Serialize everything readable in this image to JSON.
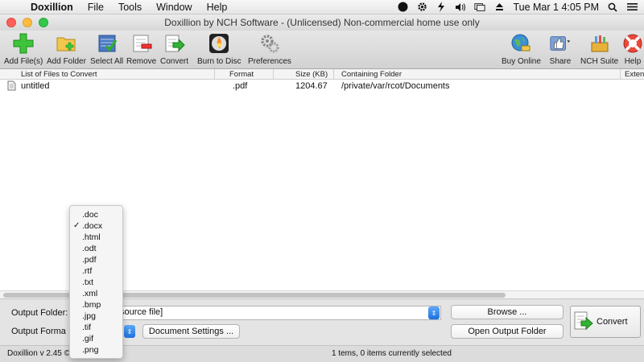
{
  "menubar": {
    "app": "Doxillion",
    "menus": [
      "File",
      "Tools",
      "Window",
      "Help"
    ],
    "clock": "Tue Mar 1  4:05 PM"
  },
  "window": {
    "title": "Doxillion by NCH Software - (Unlicensed) Non-commercial home use only"
  },
  "toolbar": {
    "add_files": "Add File(s)",
    "add_folder": "Add Folder",
    "select_all": "Select All",
    "remove": "Remove",
    "convert": "Convert",
    "burn": "Burn to Disc",
    "preferences": "Preferences",
    "buy_online": "Buy Online",
    "share": "Share",
    "nch_suite": "NCH Suite",
    "help": "Help"
  },
  "list": {
    "columns": {
      "name": "List of Files to Convert",
      "format": "Format",
      "size": "Size (KB)",
      "folder": "Containing Folder",
      "ext": "Exten"
    },
    "rows": [
      {
        "name": "untitled",
        "format": ".pdf",
        "size": "1204.67",
        "folder": "/private/var/rcot/Documents"
      }
    ]
  },
  "bottom": {
    "output_folder_label": "Output Folder:",
    "output_folder_value": "source file]",
    "output_format_label": "Output Forma",
    "browse": "Browse ...",
    "open_output": "Open Output Folder",
    "document_settings": "Document Settings ...",
    "convert": "Convert"
  },
  "status": {
    "version": "Doxillion v 2.45 ©",
    "selection": "1  tems, 0 items currently selected"
  },
  "dropdown": {
    "options": [
      ".doc",
      ".docx",
      ".html",
      ".odt",
      ".pdf",
      ".rtf",
      ".txt",
      ".xml",
      ".bmp",
      ".jpg",
      ".tif",
      ".gif",
      ".png"
    ],
    "selected": ".docx",
    "check": "✓"
  },
  "colors": {
    "accent": "#1d6fe0",
    "traffic_red": "#fc605c",
    "traffic_yellow": "#fdbc40",
    "traffic_green": "#34c84a"
  }
}
